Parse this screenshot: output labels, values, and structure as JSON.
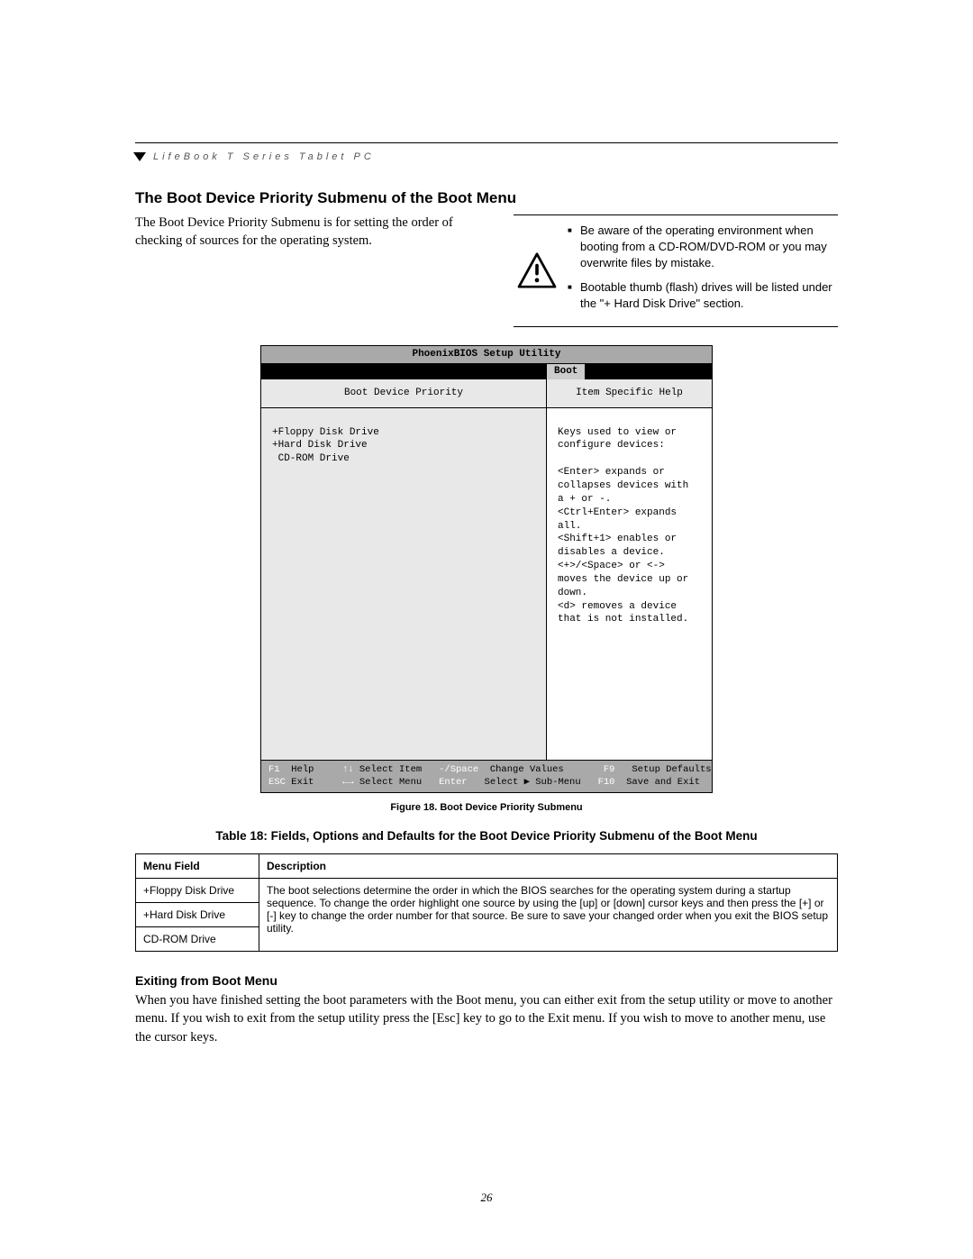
{
  "header": {
    "product_line": "LifeBook T Series Tablet PC"
  },
  "section": {
    "title": "The Boot Device Priority Submenu of the Boot Menu",
    "intro": "The Boot Device Priority Submenu is for setting the order of checking of sources for the operating system."
  },
  "caution": {
    "items": [
      "Be aware of the operating environment when booting from a CD-ROM/DVD-ROM or you may overwrite files by mistake.",
      "Bootable thumb (flash) drives will be listed under the \"+ Hard Disk Drive\" section."
    ]
  },
  "bios": {
    "title": "PhoenixBIOS Setup Utility",
    "tab": "Boot",
    "left_heading": "Boot Device Priority",
    "right_heading": "Item Specific Help",
    "devices": [
      "+Floppy Disk Drive",
      "+Hard Disk Drive",
      " CD-ROM Drive"
    ],
    "help_text": "Keys used to view or\nconfigure devices:\n\n<Enter> expands or\ncollapses devices with\na + or -.\n<Ctrl+Enter> expands\nall.\n<Shift+1> enables or\ndisables a device.\n<+>/<Space> or <->\nmoves the device up or\ndown.\n<d> removes a device\nthat is not installed.",
    "footer": {
      "r1": {
        "f1": "F1",
        "help": "Help",
        "arrows_v": "↑↓",
        "sel_item": "Select Item",
        "minus": "-/Space",
        "chg": "Change Values",
        "f9": "F9",
        "setup_def": "Setup Defaults"
      },
      "r2": {
        "esc": "ESC",
        "exit": "Exit",
        "arrows_h": "←→",
        "sel_menu": "Select Menu",
        "enter": "Enter",
        "sel_sub": "Select ▶ Sub-Menu",
        "f10": "F10",
        "save": "Save and Exit"
      }
    }
  },
  "figure_caption": "Figure 18.  Boot Device Priority Submenu",
  "table_caption": "Table 18: Fields, Options and Defaults for the Boot Device Priority Submenu of the Boot Menu",
  "table": {
    "head": {
      "c1": "Menu Field",
      "c2": "Description"
    },
    "rows": [
      "+Floppy Disk Drive",
      "+Hard Disk Drive",
      "CD-ROM Drive"
    ],
    "description": "The boot selections determine the order in which the BIOS searches for the operating system during a startup sequence. To change the order highlight one source by using the [up] or [down] cursor keys and then press the [+] or [-] key to change the order number for that source. Be sure to save your changed order when you exit the BIOS setup utility."
  },
  "exiting": {
    "heading": "Exiting from Boot Menu",
    "body": "When you have finished setting the boot parameters with the Boot menu, you can either exit from the setup utility or move to another menu. If you wish to exit from the setup utility press the [Esc] key to go to the Exit menu. If you wish to move to another menu, use the cursor keys."
  },
  "page_number": "26"
}
